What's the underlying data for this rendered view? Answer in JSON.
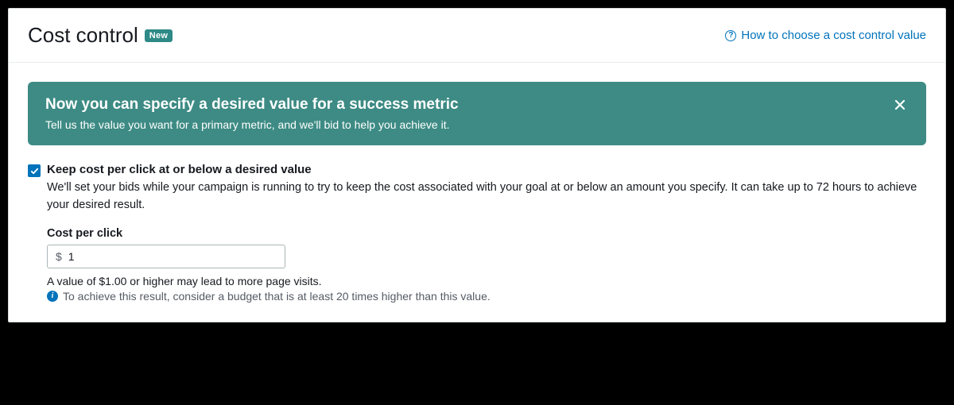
{
  "header": {
    "title": "Cost control",
    "badge": "New",
    "help_link": "How to choose a cost control value"
  },
  "banner": {
    "title": "Now you can specify a desired value for a success metric",
    "subtitle": "Tell us the value you want for a primary metric, and we'll bid to help you achieve it."
  },
  "option": {
    "title": "Keep cost per click at or below a desired value",
    "description": "We'll set your bids while your campaign is running to try to keep the cost associated with your goal at or below an amount you specify. It can take up to 72 hours to achieve your desired result.",
    "checked": true
  },
  "field": {
    "label": "Cost per click",
    "currency": "$",
    "value": "1",
    "hint": "A value of $1.00 or higher may lead to more page visits.",
    "info": "To achieve this result, consider a budget that is at least 20 times higher than this value."
  }
}
